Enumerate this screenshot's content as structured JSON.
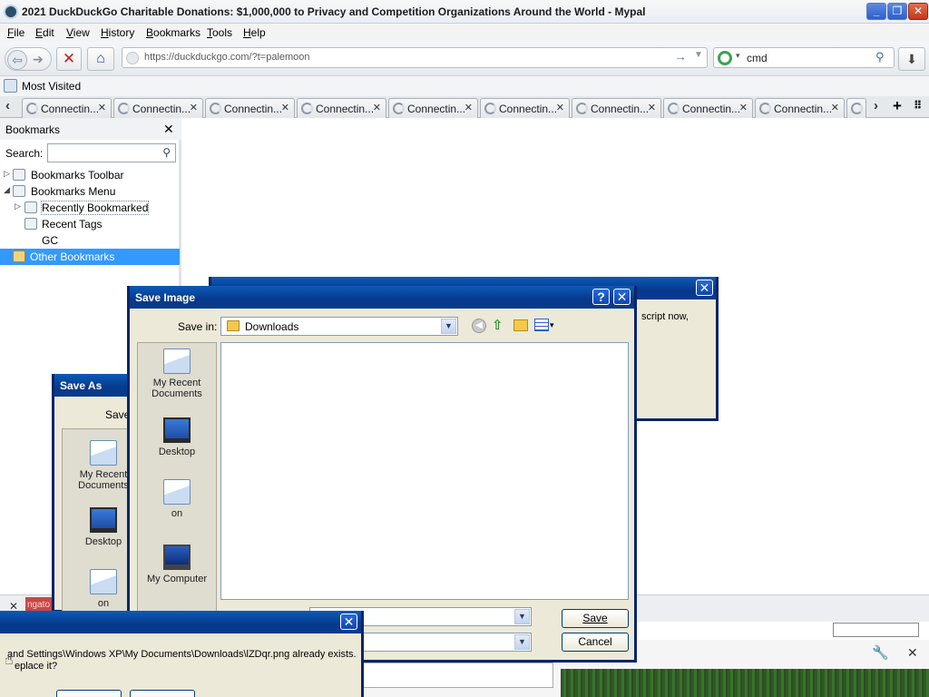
{
  "window": {
    "title": "2021 DuckDuckGo Charitable Donations: $1,000,000 to Privacy and Competition Organizations Around the World - Mypal",
    "controls": [
      "_",
      "❐",
      "✕"
    ]
  },
  "menubar": [
    "File",
    "Edit",
    "View",
    "History",
    "Bookmarks",
    "Tools",
    "Help"
  ],
  "navbar": {
    "url": "https://duckduckgo.com/?t=palemoon",
    "search_query": "cmd"
  },
  "bookmarks_toolbar": {
    "most_visited": "Most Visited"
  },
  "tabs": [
    "Connectin...",
    "Connectin...",
    "Connectin...",
    "Connectin...",
    "Connectin...",
    "Connectin...",
    "Connectin...",
    "Connectin...",
    "Connectin..."
  ],
  "sidebar": {
    "title": "Bookmarks",
    "search_label": "Search:",
    "items": [
      {
        "label": "Bookmarks Toolbar",
        "twisty": "▷"
      },
      {
        "label": "Bookmarks Menu",
        "twisty": "◢"
      },
      {
        "label": "Recently Bookmarked",
        "twisty": "▷"
      },
      {
        "label": "Recent Tags",
        "twisty": ""
      },
      {
        "label": "GC",
        "twisty": ""
      },
      {
        "label": "Other Bookmarks",
        "twisty": ""
      }
    ]
  },
  "script_dialog": {
    "text": "script now,"
  },
  "save_as_dialog": {
    "title": "Save As",
    "save_in_fragment": "Save",
    "places": [
      "My Recent Documents",
      "Desktop",
      "on"
    ]
  },
  "save_image_dialog": {
    "title": "Save Image",
    "help": "?",
    "save_in_label": "Save in:",
    "folder": "Downloads",
    "places": [
      "My Recent Documents",
      "Desktop",
      "on",
      "My Computer"
    ],
    "save_button": "Save",
    "cancel_button": "Cancel"
  },
  "confirm_dialog": {
    "line1": "and Settings\\Windows XP\\My Documents\\Downloads\\lZDqr.png already exists.",
    "line2": "eplace it?"
  },
  "bottom": {
    "red_tag": "ngato"
  }
}
